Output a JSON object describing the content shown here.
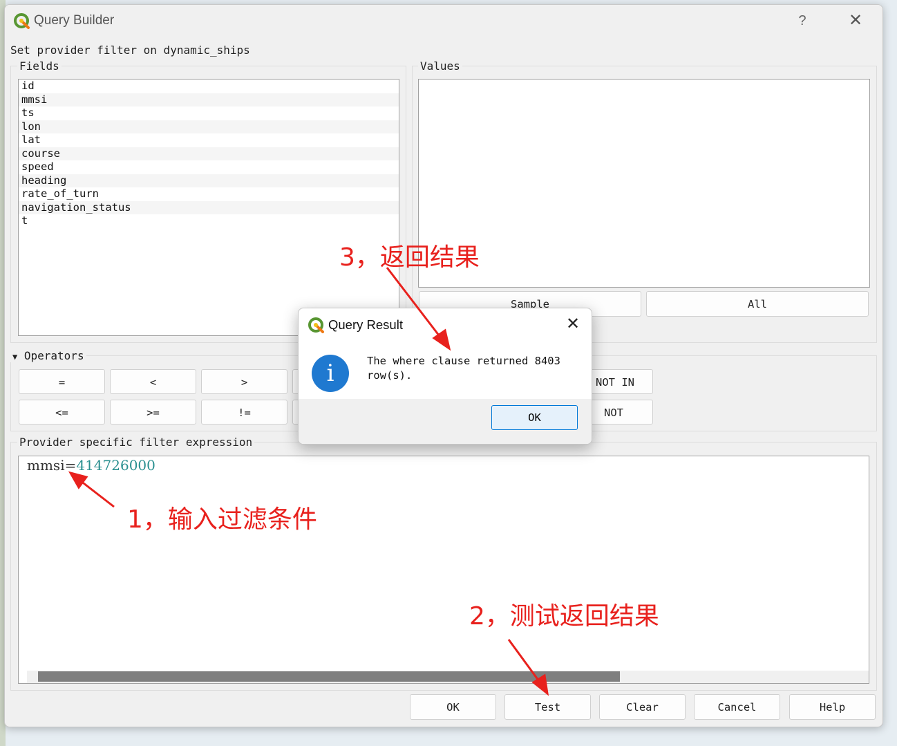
{
  "window": {
    "title": "Query Builder",
    "help_label": "?",
    "close_label": "✕",
    "subtitle": "Set provider filter on dynamic_ships"
  },
  "fields": {
    "label": "Fields",
    "items": [
      "id",
      "mmsi",
      "ts",
      "lon",
      "lat",
      "course",
      "speed",
      "heading",
      "rate_of_turn",
      "navigation_status",
      "t"
    ]
  },
  "values": {
    "label": "Values",
    "sample_label": "Sample",
    "all_label": "All"
  },
  "operators": {
    "label": "Operators",
    "row1": [
      "=",
      "<",
      ">"
    ],
    "row2": [
      "<=",
      ">=",
      "!="
    ],
    "right_row1": "NOT IN",
    "right_row2": "NOT"
  },
  "expression": {
    "label": "Provider specific filter expression",
    "field": "mmsi",
    "operator": "=",
    "value": "414726000"
  },
  "buttons": {
    "ok": "OK",
    "test": "Test",
    "clear": "Clear",
    "cancel": "Cancel",
    "help": "Help"
  },
  "popup": {
    "title": "Query Result",
    "close_label": "✕",
    "icon_glyph": "i",
    "message": "The where clause returned 8403 row(s).",
    "ok_label": "OK"
  },
  "annotations": {
    "step1": "1，输入过滤条件",
    "step2": "2，测试返回结果",
    "step3": "3，返回结果"
  },
  "colors": {
    "accent": "#0078d7",
    "annotation": "#e8211d",
    "expression_value": "#2a9090",
    "info_icon": "#1f79d0"
  }
}
